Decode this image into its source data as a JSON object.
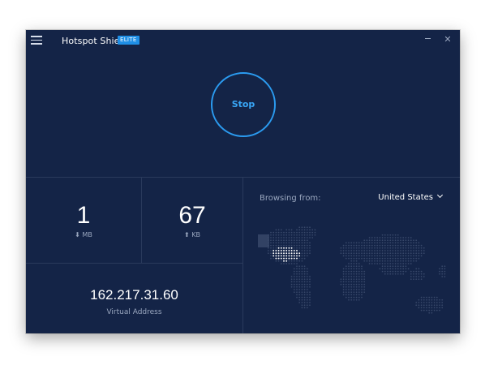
{
  "app": {
    "title": "Hotspot Shield",
    "badge": "ELITE"
  },
  "connection": {
    "stop_label": "Stop"
  },
  "stats": {
    "download_value": "1",
    "download_unit": "⬇ MB",
    "upload_value": "67",
    "upload_unit": "⬆ KB"
  },
  "address": {
    "ip": "162.217.31.60",
    "label": "Virtual Address"
  },
  "location": {
    "browsing_label": "Browsing from:",
    "country": "United States"
  },
  "colors": {
    "background": "#142447",
    "accent": "#2b9bf0",
    "badge": "#1f8fe6",
    "highlight_region": "#ffffff",
    "map_dots": "#3a4a6c"
  },
  "icons": {
    "menu": "hamburger-icon",
    "minimize": "minimize-icon",
    "close": "close-icon",
    "dropdown": "chevron-down-icon"
  }
}
